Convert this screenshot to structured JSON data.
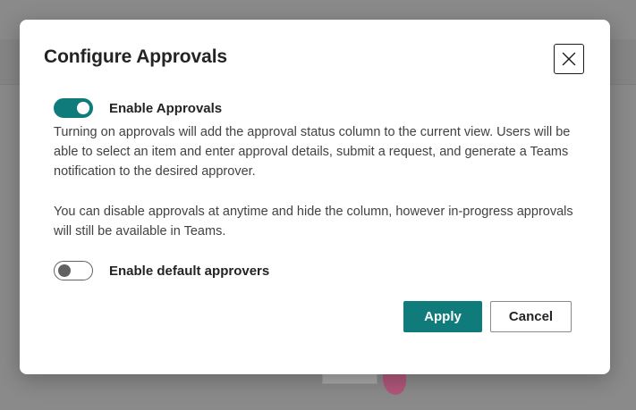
{
  "dialog": {
    "title": "Configure Approvals",
    "close_icon": "close-icon"
  },
  "approvals_toggle": {
    "label": "Enable Approvals",
    "state": "on"
  },
  "description": {
    "paragraph1": "Turning on approvals will add the approval status column to the current view. Users will be able to select an item and enter approval details, submit a request, and generate a Teams notification to the desired approver.",
    "paragraph2": "You can disable approvals at anytime and hide the column, however in-progress approvals will still be available in Teams."
  },
  "default_approvers_toggle": {
    "label": "Enable default approvers",
    "state": "off"
  },
  "buttons": {
    "apply_label": "Apply",
    "cancel_label": "Cancel"
  },
  "colors": {
    "accent": "#0f7b7b",
    "text": "#242424",
    "overlay": "#8a8a8a"
  }
}
